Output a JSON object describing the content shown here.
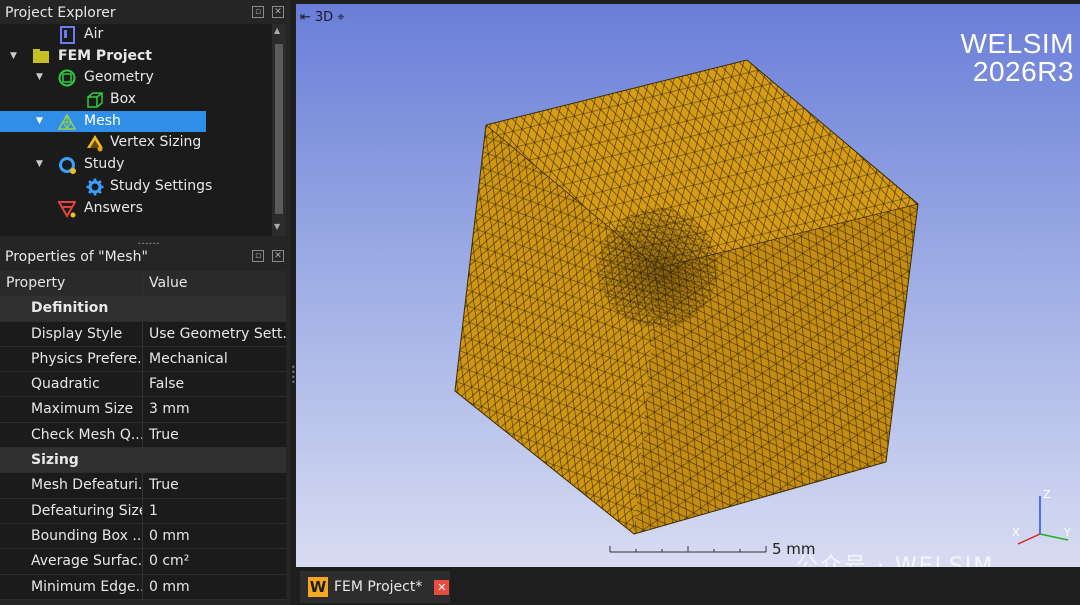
{
  "explorer": {
    "title": "Project Explorer",
    "items": [
      {
        "label": "Air",
        "icon": "material-icon"
      },
      {
        "label": "FEM Project",
        "icon": "project-folder-icon"
      },
      {
        "label": "Geometry",
        "icon": "geometry-icon"
      },
      {
        "label": "Box",
        "icon": "box-body-icon"
      },
      {
        "label": "Mesh",
        "icon": "mesh-icon"
      },
      {
        "label": "Vertex Sizing",
        "icon": "vertex-sizing-icon"
      },
      {
        "label": "Study",
        "icon": "study-icon"
      },
      {
        "label": "Study Settings",
        "icon": "study-settings-icon"
      },
      {
        "label": "Answers",
        "icon": "answers-icon"
      }
    ]
  },
  "properties": {
    "title": "Properties of \"Mesh\"",
    "col_property": "Property",
    "col_value": "Value",
    "rows": [
      {
        "section": "Definition"
      },
      {
        "name": "Display Style",
        "value": "Use Geometry Sett..."
      },
      {
        "name": "Physics Prefere...",
        "value": "Mechanical"
      },
      {
        "name": "Quadratic",
        "value": "False"
      },
      {
        "name": "Maximum Size",
        "value": "3 mm"
      },
      {
        "name": "Check Mesh Q...",
        "value": "True"
      },
      {
        "section": "Sizing"
      },
      {
        "name": "Mesh Defeaturi...",
        "value": "True"
      },
      {
        "name": "Defeaturing Size",
        "value": "1"
      },
      {
        "name": "Bounding Box ...",
        "value": "0 mm"
      },
      {
        "name": "Average Surfac...",
        "value": "0 cm²"
      },
      {
        "name": "Minimum Edge...",
        "value": "0 mm"
      }
    ]
  },
  "viewport": {
    "mode_label": "3D",
    "brand_line1": "WELSIM",
    "brand_line2": "2026R3",
    "scale_label": "5 mm",
    "axis_x": "X",
    "axis_y": "Y",
    "axis_z": "Z",
    "mesh_color": "#d49a14",
    "watermark": "公众号 · WELSIM"
  },
  "tab": {
    "label": "FEM Project*",
    "logo": "W"
  }
}
